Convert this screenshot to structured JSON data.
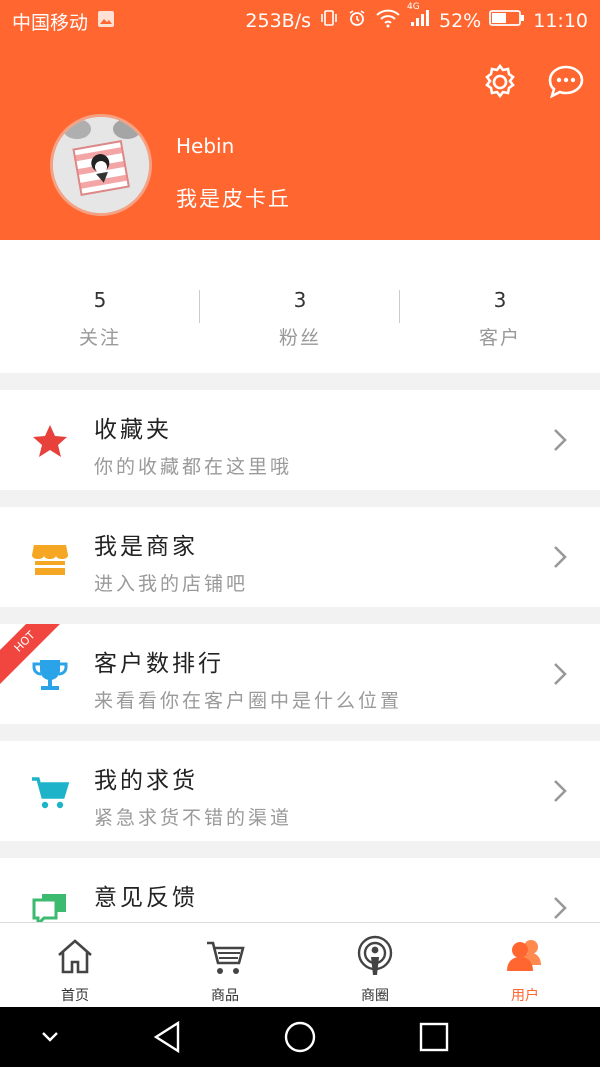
{
  "status_bar": {
    "carrier": "中国移动",
    "speed": "253B/s",
    "network": "4G",
    "battery": "52%",
    "time": "11:10"
  },
  "header": {
    "username": "Hebin",
    "signature": "我是皮卡丘",
    "icons": [
      "settings-icon",
      "message-icon"
    ]
  },
  "stats": [
    {
      "value": "5",
      "label": "关注"
    },
    {
      "value": "3",
      "label": "粉丝"
    },
    {
      "value": "3",
      "label": "客户"
    }
  ],
  "menu": [
    {
      "title": "收藏夹",
      "subtitle": "你的收藏都在这里哦",
      "icon": "star-icon"
    },
    {
      "title": "我是商家",
      "subtitle": "进入我的店铺吧",
      "icon": "shop-icon"
    },
    {
      "title": "客户数排行",
      "subtitle": "来看看你在客户圈中是什么位置",
      "icon": "trophy-icon",
      "badge": "HOT"
    },
    {
      "title": "我的求货",
      "subtitle": "紧急求货不错的渠道",
      "icon": "cart-icon"
    },
    {
      "title": "意见反馈",
      "subtitle": "",
      "icon": "feedback-icon"
    }
  ],
  "bottom_nav": [
    {
      "label": "首页",
      "icon": "home-icon"
    },
    {
      "label": "商品",
      "icon": "cart-icon"
    },
    {
      "label": "商圈",
      "icon": "podcast-icon"
    },
    {
      "label": "用户",
      "icon": "user-icon",
      "active": true
    }
  ],
  "colors": {
    "brand": "#ff6630",
    "hot_badge": "#f0463f",
    "star": "#e8403a",
    "shop": "#f5a623",
    "trophy": "#2aa3e8",
    "cart": "#1fb3c9",
    "feedback": "#3cba6f"
  }
}
